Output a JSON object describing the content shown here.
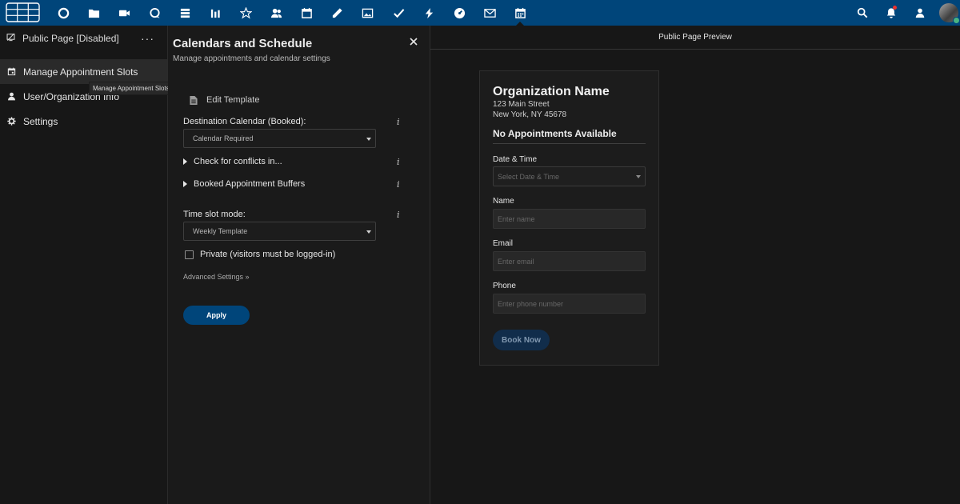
{
  "topbar": {
    "apps": [
      {
        "icon": "circle-icon"
      },
      {
        "icon": "folder-icon"
      },
      {
        "icon": "video-icon"
      },
      {
        "icon": "chat-icon"
      },
      {
        "icon": "stack-icon"
      },
      {
        "icon": "bar-chart-icon"
      },
      {
        "icon": "star-icon"
      },
      {
        "icon": "contacts-icon"
      },
      {
        "icon": "calendar-icon"
      },
      {
        "icon": "pencil-icon"
      },
      {
        "icon": "image-icon"
      },
      {
        "icon": "check-icon"
      },
      {
        "icon": "bolt-icon"
      },
      {
        "icon": "dashboard-icon"
      },
      {
        "icon": "mail-icon"
      },
      {
        "icon": "appointments-icon"
      }
    ],
    "accent_color": "#00457a"
  },
  "sidebar": {
    "header_label": "Public Page [Disabled]",
    "more_label": "···",
    "items": [
      {
        "label": "Manage Appointment Slots",
        "icon": "calendar-icon"
      },
      {
        "label": "User/Organization Info",
        "icon": "user-icon"
      },
      {
        "label": "Settings",
        "icon": "gear-icon"
      }
    ],
    "tooltip": "Manage Appointment Slots"
  },
  "panel": {
    "title": "Calendars and Schedule",
    "subtitle": "Manage appointments and calendar settings",
    "edit_template": "Edit Template",
    "destination_label": "Destination Calendar (Booked):",
    "destination_value": "Calendar Required",
    "conflicts_label": "Check for conflicts in...",
    "buffers_label": "Booked Appointment Buffers",
    "time_slot_label": "Time slot mode:",
    "time_slot_value": "Weekly Template",
    "private_label": "Private (visitors must be logged-in)",
    "advanced_label": "Advanced Settings »",
    "apply_label": "Apply",
    "info_glyph": "i"
  },
  "preview": {
    "heading": "Public Page Preview",
    "org_name": "Organization Name",
    "address_line1": "123 Main Street",
    "address_line2": "New York, NY 45678",
    "no_appointments": "No Appointments Available",
    "date_label": "Date & Time",
    "date_placeholder": "Select Date & Time",
    "name_label": "Name",
    "name_placeholder": "Enter name",
    "email_label": "Email",
    "email_placeholder": "Enter email",
    "phone_label": "Phone",
    "phone_placeholder": "Enter phone number",
    "book_label": "Book Now"
  }
}
